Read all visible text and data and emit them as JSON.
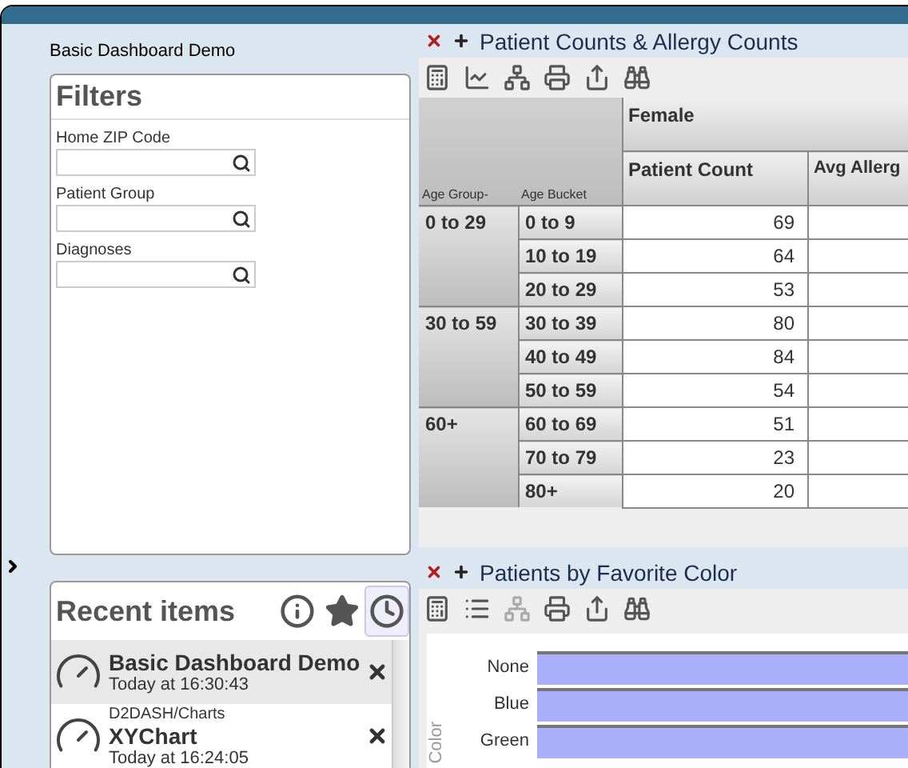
{
  "header": {
    "title": "Basic Dashboard Demo"
  },
  "filters": {
    "title": "Filters",
    "fields": [
      {
        "label": "Home ZIP Code"
      },
      {
        "label": "Patient Group"
      },
      {
        "label": "Diagnoses"
      }
    ]
  },
  "recent": {
    "title": "Recent items",
    "views": [
      {
        "kind": "info",
        "selected": false
      },
      {
        "kind": "favorites",
        "selected": false
      },
      {
        "kind": "history",
        "selected": true
      }
    ],
    "items": [
      {
        "title": "Basic Dashboard Demo",
        "time": "Today at 16:30:43",
        "selected": true
      },
      {
        "path": "D2DASH/Charts",
        "title": "XYChart",
        "time": "Today at 16:24:05",
        "selected": false
      }
    ]
  },
  "pivot_panel": {
    "title": "Patient Counts & Allergy Counts",
    "tools": [
      {
        "kind": "calculator",
        "disabled": false
      },
      {
        "kind": "chart",
        "disabled": false
      },
      {
        "kind": "hierarchy",
        "disabled": false
      },
      {
        "kind": "print",
        "disabled": false
      },
      {
        "kind": "export",
        "disabled": false
      },
      {
        "kind": "find",
        "disabled": false
      }
    ],
    "column_group": "Female",
    "measures": [
      "Patient Count",
      "Avg Allerg"
    ],
    "row_headers": [
      "Age Group-",
      "Age Bucket"
    ],
    "groups": [
      {
        "label": "0 to 29",
        "rows": [
          {
            "bucket": "0 to 9",
            "count": "69"
          },
          {
            "bucket": "10 to 19",
            "count": "64"
          },
          {
            "bucket": "20 to 29",
            "count": "53"
          }
        ]
      },
      {
        "label": "30 to 59",
        "rows": [
          {
            "bucket": "30 to 39",
            "count": "80"
          },
          {
            "bucket": "40 to 49",
            "count": "84"
          },
          {
            "bucket": "50 to 59",
            "count": "54"
          }
        ]
      },
      {
        "label": "60+",
        "rows": [
          {
            "bucket": "60 to 69",
            "count": "51"
          },
          {
            "bucket": "70 to 79",
            "count": "23"
          },
          {
            "bucket": "80+",
            "count": "20"
          }
        ]
      }
    ]
  },
  "chart_panel": {
    "title": "Patients by Favorite Color",
    "tools": [
      {
        "kind": "calculator",
        "disabled": false
      },
      {
        "kind": "list",
        "disabled": false
      },
      {
        "kind": "hierarchy",
        "disabled": true
      },
      {
        "kind": "print",
        "disabled": false
      },
      {
        "kind": "export",
        "disabled": false
      },
      {
        "kind": "find",
        "disabled": false
      }
    ],
    "axis_label": "Color",
    "bar_labels": [
      "None",
      "Blue",
      "Green"
    ]
  }
}
